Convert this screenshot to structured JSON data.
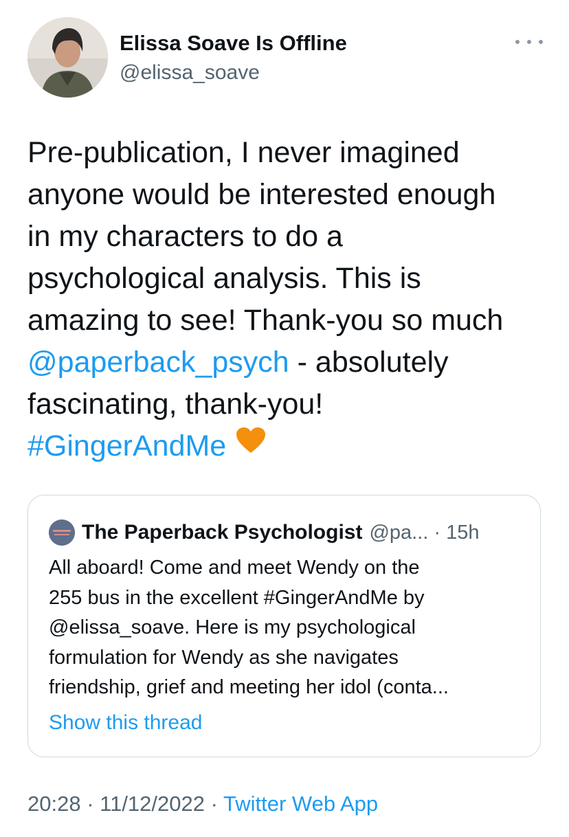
{
  "author": {
    "display_name": "Elissa Soave Is Offline",
    "handle": "@elissa_soave"
  },
  "tweet": {
    "lines": [
      [
        {
          "text": "Pre-publication, I never imagined",
          "link": false
        }
      ],
      [
        {
          "text": "anyone would be interested enough",
          "link": false
        }
      ],
      [
        {
          "text": "in my characters to do a",
          "link": false
        }
      ],
      [
        {
          "text": "psychological analysis. This is",
          "link": false
        }
      ],
      [
        {
          "text": "amazing to see! Thank-you so much",
          "link": false
        }
      ],
      [
        {
          "text": "@paperback_psych",
          "link": true
        },
        {
          "text": " - absolutely",
          "link": false
        }
      ],
      [
        {
          "text": "fascinating, thank-you!",
          "link": false
        }
      ],
      [
        {
          "text": "#GingerAndMe",
          "link": true
        }
      ]
    ],
    "emoji": "orange-heart"
  },
  "quoted_tweet": {
    "name": "The Paperback Psychologist",
    "handle_time": "@pa... · 15h",
    "lines": [
      "All aboard! Come and meet Wendy on the",
      "255 bus in the excellent #GingerAndMe by",
      "@elissa_soave. Here is my psychological",
      "formulation for Wendy as she navigates",
      "friendship, grief and meeting her idol (conta..."
    ],
    "show_thread": "Show this thread"
  },
  "meta": {
    "time": "20:28",
    "separator": " · ",
    "date": "11/12/2022",
    "source": "Twitter Web App"
  },
  "colors": {
    "link": "#1d9bf0",
    "secondary_text": "#536471",
    "primary_text": "#0f1419",
    "border": "#cfd9de",
    "heart": "#f4900c"
  }
}
